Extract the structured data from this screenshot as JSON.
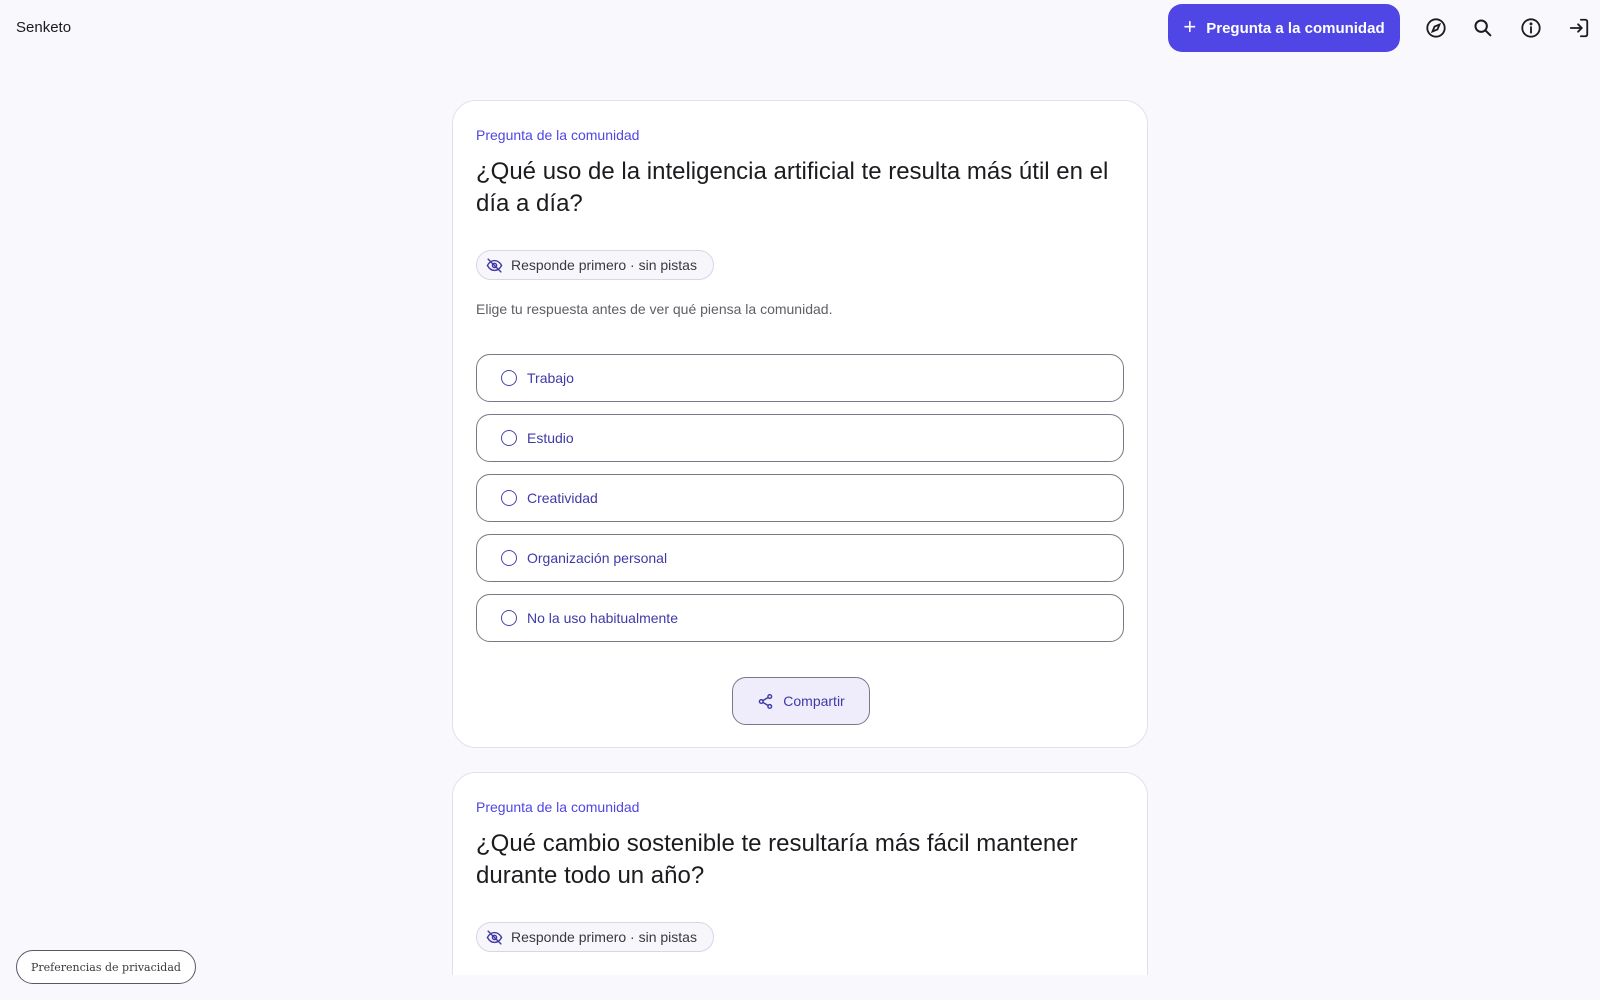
{
  "app": {
    "brand": "Senketo"
  },
  "header": {
    "ask_button_label": "Pregunta a la comunidad",
    "icons": [
      "compass-icon",
      "search-icon",
      "info-icon",
      "login-icon"
    ]
  },
  "colors": {
    "accent": "#4f46e5",
    "option_text": "#3f3aa8",
    "background": "#f9f8fc"
  },
  "cards": [
    {
      "eyebrow": "Pregunta de la comunidad",
      "question": "¿Qué uso de la inteligencia artificial te resulta más útil en el día a día?",
      "chip": "Responde primero · sin pistas",
      "hint": "Elige tu respuesta antes de ver qué piensa la comunidad.",
      "options": [
        "Trabajo",
        "Estudio",
        "Creatividad",
        "Organización personal",
        "No la uso habitualmente"
      ],
      "share_label": "Compartir"
    },
    {
      "eyebrow": "Pregunta de la comunidad",
      "question": "¿Qué cambio sostenible te resultaría más fácil mantener durante todo un año?",
      "chip": "Responde primero · sin pistas"
    }
  ],
  "footer": {
    "privacy_label": "Preferencias de privacidad"
  }
}
